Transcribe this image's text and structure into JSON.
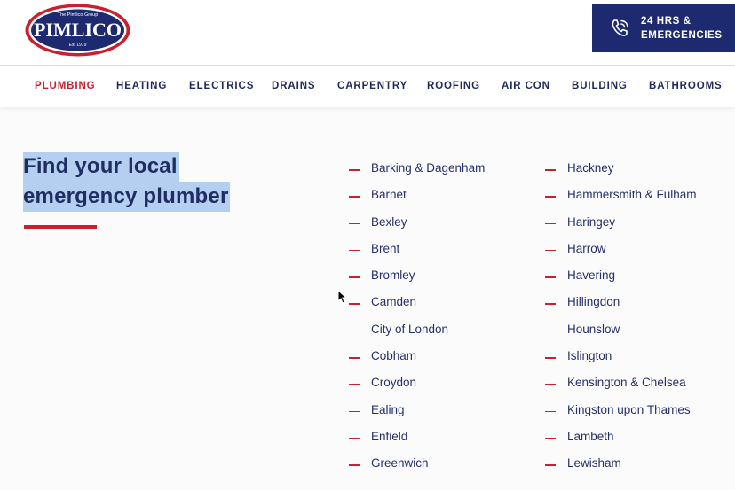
{
  "header": {
    "logo": {
      "group_text": "The Pimlico Group",
      "name": "PIMLICO",
      "est": "Est 1979"
    },
    "emergency": {
      "line1": "24 HRS &",
      "line2": "EMERGENCIES",
      "icon": "phone-ringing-icon"
    }
  },
  "nav": {
    "items": [
      {
        "label": "PLUMBING",
        "active": true
      },
      {
        "label": "HEATING"
      },
      {
        "label": "ELECTRICS"
      },
      {
        "label": "DRAINS"
      },
      {
        "label": "CARPENTRY"
      },
      {
        "label": "ROOFING"
      },
      {
        "label": "AIR CON"
      },
      {
        "label": "BUILDING"
      },
      {
        "label": "BATHROOMS"
      }
    ]
  },
  "main": {
    "heading_line1": "Find your local",
    "heading_line2": "emergency plumber",
    "areas_col1": [
      "Barking & Dagenham",
      "Barnet",
      "Bexley",
      "Brent",
      "Bromley",
      "Camden",
      "City of London",
      "Cobham",
      "Croydon",
      "Ealing",
      "Enfield",
      "Greenwich"
    ],
    "areas_col2": [
      "Hackney",
      "Hammersmith & Fulham",
      "Haringey",
      "Harrow",
      "Havering",
      "Hillingdon",
      "Hounslow",
      "Islington",
      "Kensington & Chelsea",
      "Kingston upon Thames",
      "Lambeth",
      "Lewisham"
    ]
  },
  "colors": {
    "navy": "#1d2a6f",
    "accent_red": "#c8202f",
    "selection": "#b4cff0"
  }
}
